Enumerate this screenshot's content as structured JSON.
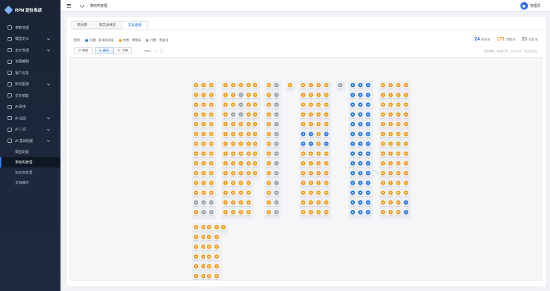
{
  "app": {
    "title": "RPM 定价系统"
  },
  "sidebar": {
    "items": [
      {
        "label": "参数管理",
        "icon": "settings-icon",
        "chevron": false
      },
      {
        "label": "模型定义",
        "icon": "model-icon",
        "chevron": true
      },
      {
        "label": "定价管理",
        "icon": "price-icon",
        "chevron": true
      },
      {
        "label": "全图编辑",
        "icon": "edit-icon",
        "chevron": false
      },
      {
        "label": "客户信息",
        "icon": "user-icon",
        "chevron": false
      },
      {
        "label": "知识图谱",
        "icon": "graph-icon",
        "chevron": true
      },
      {
        "label": "交叉销售",
        "icon": "share-icon",
        "chevron": false
      },
      {
        "label": "AI 助手",
        "icon": "chat-icon",
        "chevron": false
      },
      {
        "label": "AI 运营",
        "icon": "ops-icon",
        "chevron": true
      },
      {
        "label": "AI 工具",
        "icon": "tool-icon",
        "chevron": true
      },
      {
        "label": "AI 基础配置",
        "icon": "config-icon",
        "chevron": true
      }
    ],
    "subitems": [
      {
        "label": "模型配置",
        "active": false
      },
      {
        "label": "表结构管理",
        "active": true
      },
      {
        "label": "知识库管理",
        "active": false
      },
      {
        "label": "文档维护",
        "active": false
      }
    ]
  },
  "header": {
    "breadcrumb": "表结构管理",
    "username": "管理员"
  },
  "tabs": [
    {
      "label": "表列表",
      "active": false
    },
    {
      "label": "表关系维护",
      "active": false
    },
    {
      "label": "关系图谱",
      "active": true
    }
  ],
  "legend": {
    "prefix": "图例:",
    "items": [
      {
        "label": "内圈 · 有关联关系",
        "color": "#2f7be5"
      },
      {
        "label": "中圈 · 零散表",
        "color": "#f0a020"
      },
      {
        "label": "外圈 · 无备注",
        "color": "#9aa0a8"
      }
    ]
  },
  "stats": [
    {
      "value": "24",
      "label": "关联表",
      "color": "#2f7be5"
    },
    {
      "value": "171",
      "label": "零散表",
      "color": "#f0a020"
    },
    {
      "value": "33",
      "label": "无备注",
      "color": "#888888"
    }
  ],
  "toolbar": {
    "refresh": "刷新",
    "layout_a": "圆形",
    "layout_b": "力导",
    "zoom": "70%",
    "minus": "−",
    "plus": "+"
  },
  "hint": "滚轮缩放 · 拖拽平移 · 点击节点 · 点击空白处",
  "graph": {
    "colors": {
      "blue": "#2f7be5",
      "orange": "#f0a020",
      "gray": "#9aa0a8"
    },
    "groups": [
      {
        "name": "group-1",
        "cols": [
          "ooo",
          "ooo",
          "ooo",
          "ooo",
          "ooo",
          "ooo",
          "ooo",
          "ooo",
          "ooo",
          "ooo",
          "ooo",
          "ooo",
          "ggg",
          "ogg"
        ]
      },
      {
        "name": "group-2",
        "cols": [
          "oooo",
          "oogo",
          "oogo",
          "oggo",
          "oooo",
          "oooo",
          "oooo",
          "oooo",
          "oooo",
          "oooo",
          "oooo",
          "oooo",
          "oooo",
          "oooo"
        ]
      },
      {
        "name": "group-3",
        "cols": [
          "o",
          "o",
          "o",
          "o",
          "o",
          "o",
          "o",
          "o",
          "o",
          "o"
        ]
      },
      {
        "name": "group-4",
        "cols": [
          "og",
          "og",
          "og",
          "og",
          "og",
          "og",
          "og",
          "og",
          "og",
          "og",
          "og",
          "og",
          "og",
          "og"
        ]
      },
      {
        "name": "group-5",
        "cols": [
          "o"
        ]
      },
      {
        "name": "group-6",
        "cols": [
          "oooo",
          "oooo",
          "oooo",
          "oooo",
          "oooo",
          "bbob",
          "bbob",
          "oooo",
          "oooo",
          "oooo",
          "oooo",
          "oooo",
          "oooo",
          "oooo"
        ]
      },
      {
        "name": "group-7",
        "cols": [
          "g"
        ]
      },
      {
        "name": "group-8",
        "cols": [
          "bbb",
          "bbb",
          "bbb",
          "bbb",
          "bbb",
          "bbb",
          "bbb",
          "bbb",
          "bbb",
          "bbb",
          "bbb",
          "bbb",
          "bbb",
          "bbb"
        ]
      },
      {
        "name": "group-9",
        "cols": [
          "oooo",
          "oooo",
          "oooo",
          "oooo",
          "oooo",
          "oooo",
          "oooo",
          "oooo",
          "oooo",
          "oooo",
          "oooo",
          "oooo",
          "ooob",
          "ooob"
        ]
      },
      {
        "name": "group-10",
        "cols": [
          "oo",
          "oo",
          "oo",
          "oo",
          "oo",
          "oo",
          "oo"
        ]
      },
      {
        "name": "group-11",
        "cols": [
          "oo",
          "oo",
          "oo",
          "oo",
          "oo",
          "oo",
          "og"
        ]
      },
      {
        "name": "group-12",
        "cols": [
          "o"
        ]
      }
    ]
  }
}
